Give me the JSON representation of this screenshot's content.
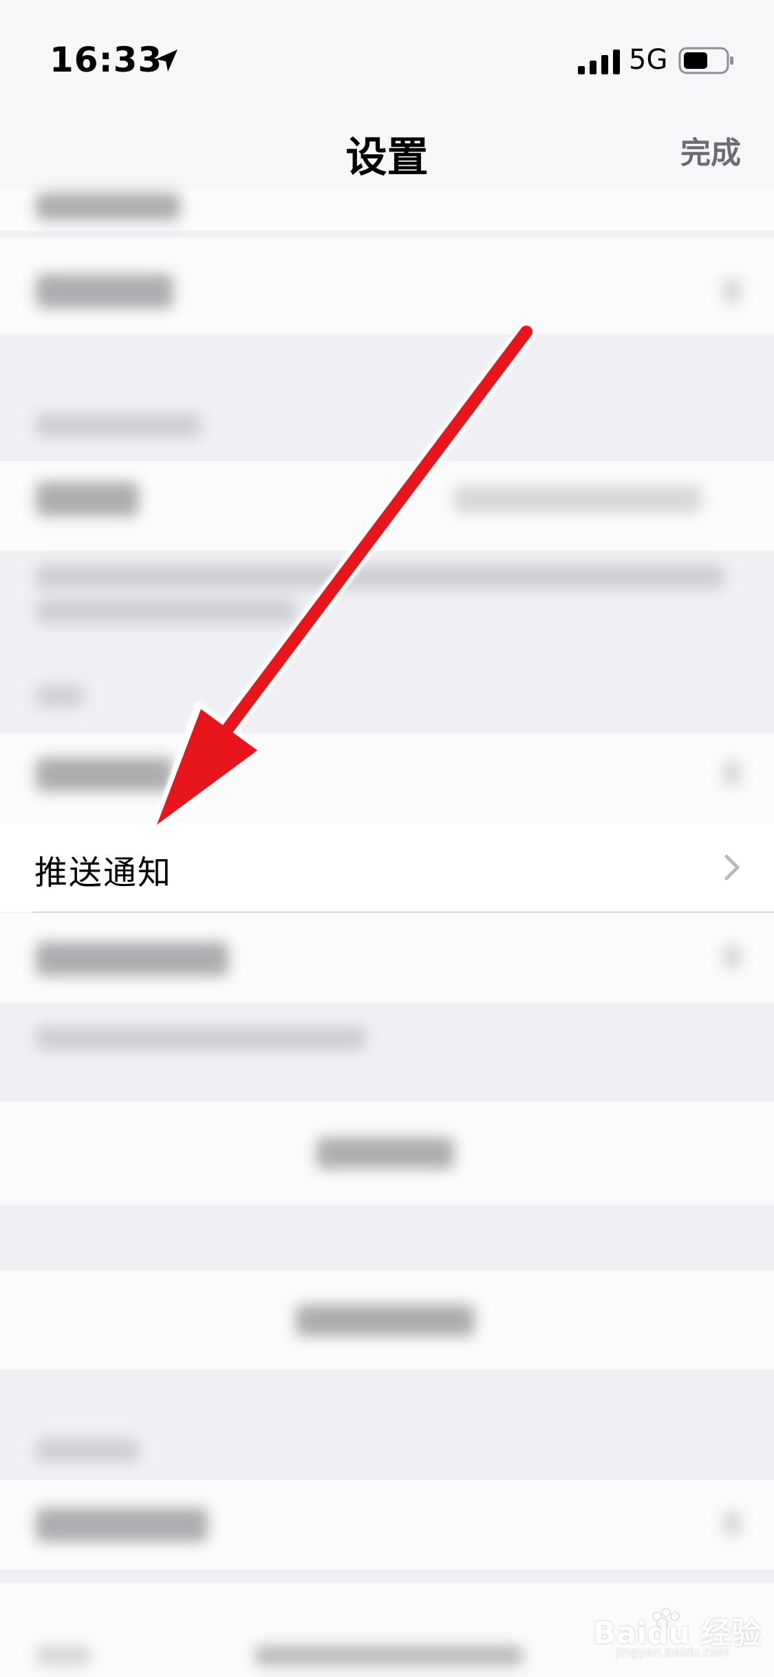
{
  "status_bar": {
    "time": "16:33",
    "network": "5G",
    "icons": [
      "location-arrow-icon",
      "signal-bars-icon",
      "battery-icon"
    ]
  },
  "nav": {
    "title": "设置",
    "done_label": "完成"
  },
  "settings": {
    "push_notifications_label": "推送通知"
  },
  "watermark": {
    "text": "Baidu 经验",
    "sub": "jingyan.baidu.com"
  },
  "colors": {
    "background": "#f0f0f4",
    "cell": "#ffffff",
    "annotation_arrow": "#e8141a",
    "secondary_text": "#6c6c70"
  }
}
